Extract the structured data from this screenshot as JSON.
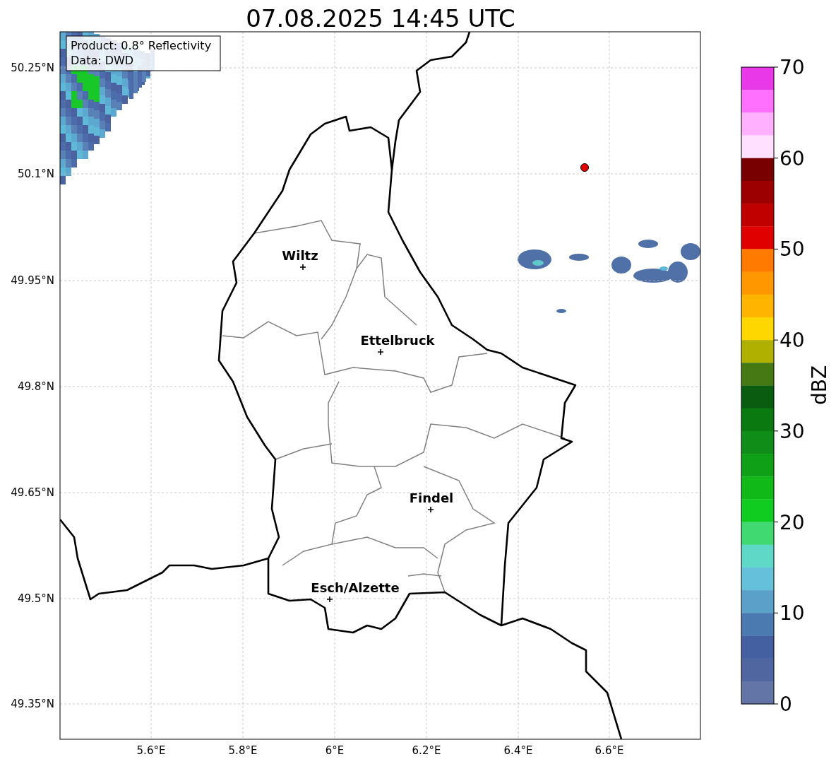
{
  "title": "07.08.2025 14:45 UTC",
  "info_box": [
    "Product: 0.8° Reflectivity",
    "Data: DWD"
  ],
  "map": {
    "y_ticks": [
      "50.25°N",
      "50.1°N",
      "49.95°N",
      "49.8°N",
      "49.65°N",
      "49.5°N",
      "49.35°N"
    ],
    "x_ticks": [
      "5.6°E",
      "5.8°E",
      "6°E",
      "6.2°E",
      "6.4°E",
      "6.6°E"
    ],
    "cities": [
      {
        "name": "Wiltz"
      },
      {
        "name": "Ettelbruck"
      },
      {
        "name": "Findel"
      },
      {
        "name": "Esch/Alzette"
      }
    ]
  },
  "colorbar": {
    "label": "dBZ",
    "ticks": [
      "70",
      "60",
      "50",
      "40",
      "30",
      "20",
      "10",
      "0"
    ],
    "segments": [
      {
        "color": "#e838e8"
      },
      {
        "color": "#ff70ff"
      },
      {
        "color": "#ffb0ff"
      },
      {
        "color": "#ffe0ff"
      },
      {
        "color": "#780000"
      },
      {
        "color": "#9c0000"
      },
      {
        "color": "#c00000"
      },
      {
        "color": "#e00000"
      },
      {
        "color": "#ff7a00"
      },
      {
        "color": "#ff9800"
      },
      {
        "color": "#ffb400"
      },
      {
        "color": "#ffd700"
      },
      {
        "color": "#b0b000"
      },
      {
        "color": "#467814"
      },
      {
        "color": "#0a5c10"
      },
      {
        "color": "#0a7a10"
      },
      {
        "color": "#108c18"
      },
      {
        "color": "#10a018"
      },
      {
        "color": "#10b818"
      },
      {
        "color": "#10cc20"
      },
      {
        "color": "#40d870"
      },
      {
        "color": "#60d8c8"
      },
      {
        "color": "#65c0dc"
      },
      {
        "color": "#5aa0c8"
      },
      {
        "color": "#4a7ab0"
      },
      {
        "color": "#4460a0"
      },
      {
        "color": "#5066a0"
      },
      {
        "color": "#6374a6"
      }
    ]
  }
}
